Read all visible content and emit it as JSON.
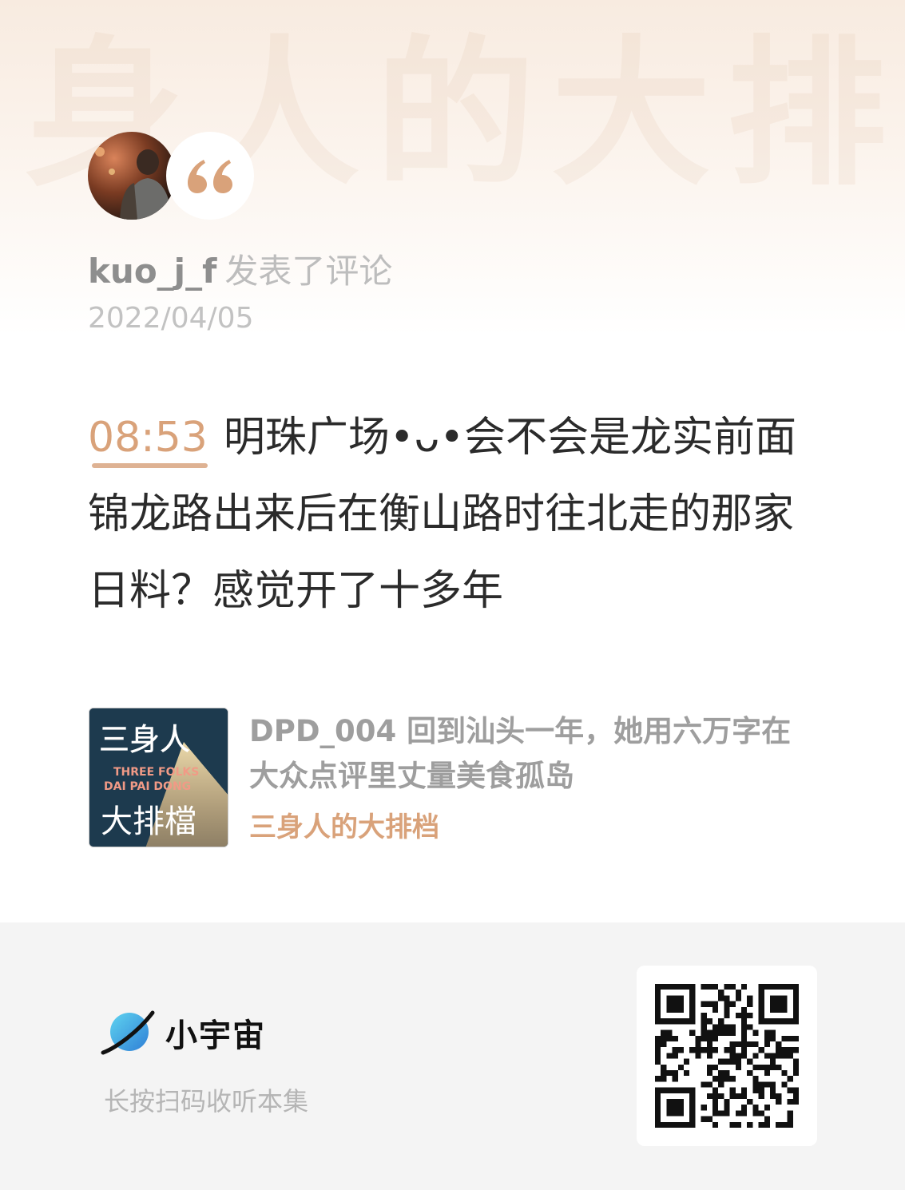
{
  "user": {
    "name": "kuo_j_f",
    "action": "发表了评论",
    "date": "2022/04/05"
  },
  "comment": {
    "timestamp": "08:53",
    "text": "明珠广场•ᴗ•会不会是龙实前面锦龙路出来后在衡山路时往北走的那家日料？感觉开了十多年"
  },
  "episode": {
    "title": "DPD_004 回到汕头一年，她用六万字在大众点评里丈量美食孤岛",
    "show": "三身人的大排档",
    "cover_text": {
      "cn_top": "三身人",
      "en_line1": "THREE FOLKS",
      "en_line2": "DAI PAI DONG",
      "cn_bottom": "大排檔"
    }
  },
  "watermark_text": "身人的大排",
  "footer": {
    "brand": "小宇宙",
    "hint": "长按扫码收听本集"
  },
  "colors": {
    "accent": "#d9a27a",
    "text_dark": "#2b2b2b",
    "text_muted": "#9e9e9e",
    "footer_bg": "#f4f4f4"
  },
  "icons": {
    "quote": "quote-icon",
    "brand_logo": "planet-icon",
    "qr": "qr-code"
  }
}
